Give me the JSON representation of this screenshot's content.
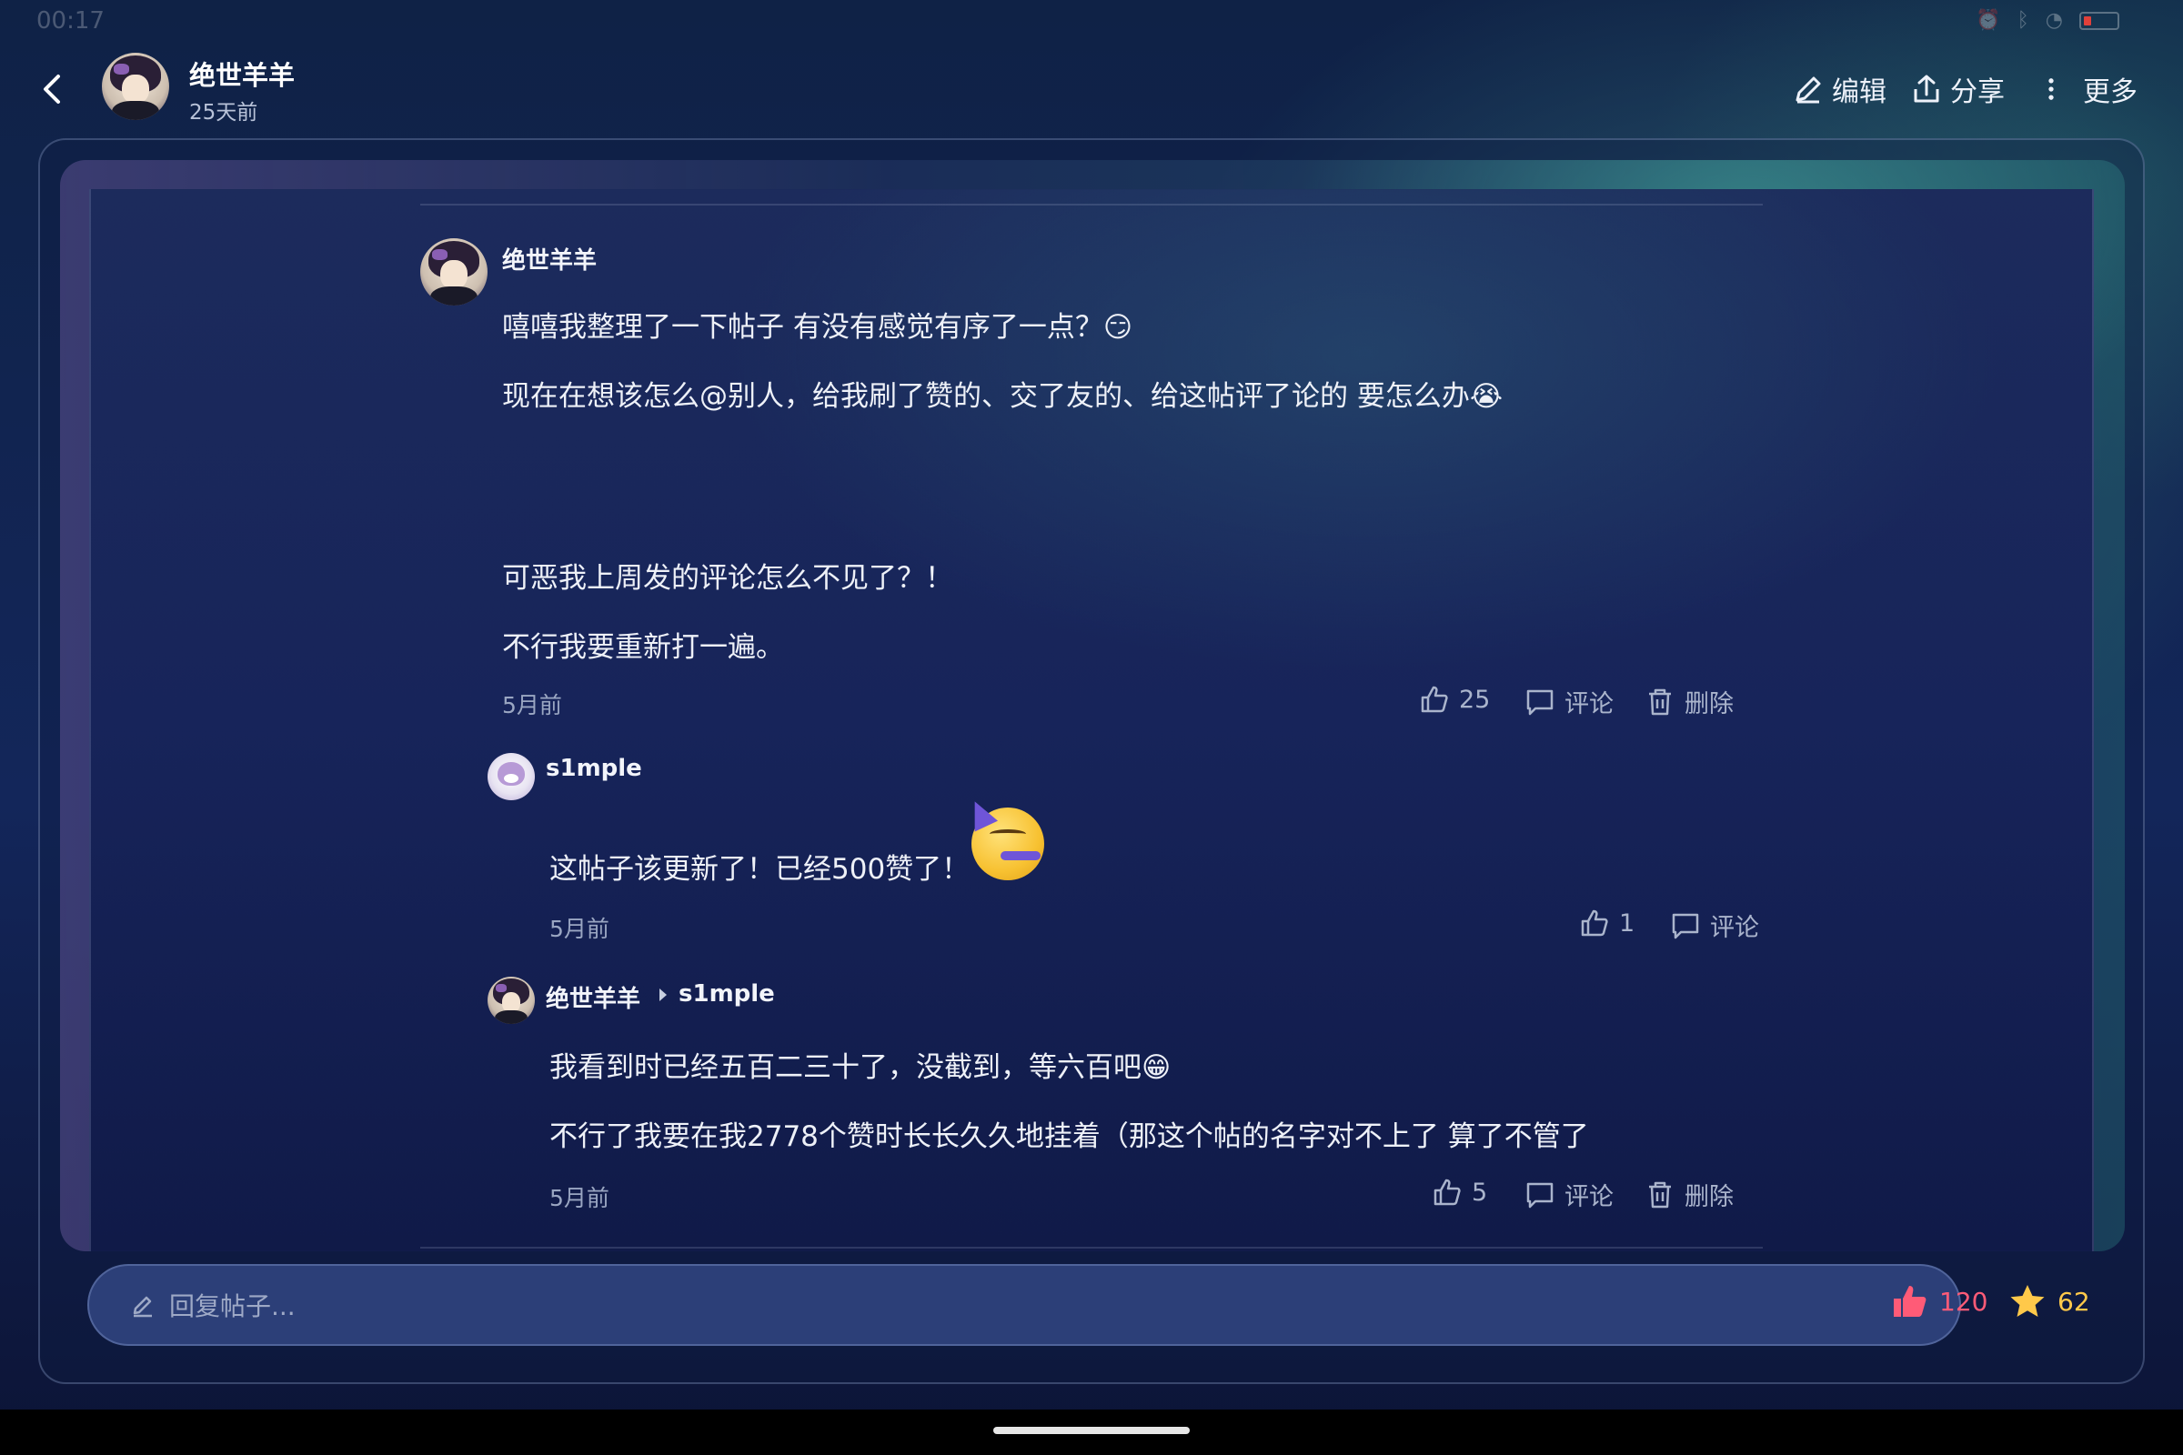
{
  "status_bar": {
    "time": "00:17"
  },
  "header": {
    "author": "绝世羊羊",
    "time": "25天前",
    "actions": {
      "edit": "编辑",
      "share": "分享",
      "more": "更多"
    }
  },
  "comments": [
    {
      "author": "绝世羊羊",
      "lines": [
        "嘻嘻我整理了一下帖子 有没有感觉有序了一点？😏",
        "现在在想该怎么@别人，给我刷了赞的、交了友的、给这帖评了论的 要怎么办😭",
        "可恶我上周发的评论怎么不见了？！",
        "不行我要重新打一遍。"
      ],
      "date": "5月前",
      "likes": "25",
      "comment_label": "评论",
      "delete_label": "删除"
    },
    {
      "author": "s1mple",
      "lines": [
        "这帖子该更新了！已经500赞了！"
      ],
      "date": "5月前",
      "likes": "1",
      "comment_label": "评论"
    },
    {
      "author": "绝世羊羊",
      "reply_to": "s1mple",
      "lines": [
        "我看到时已经五百二三十了，没截到，等六百吧😁",
        "不行了我要在我2778个赞时长长久久地挂着（那这个帖的名字对不上了 算了不管了"
      ],
      "date": "5月前",
      "likes": "5",
      "comment_label": "评论",
      "delete_label": "删除"
    }
  ],
  "reply_bar": {
    "placeholder": "回复帖子..."
  },
  "totals": {
    "likes": "120",
    "favorites": "62"
  },
  "colors": {
    "like": "#ff5b77",
    "favorite": "#ffc94a",
    "accent_bg": "#2c3f78"
  }
}
